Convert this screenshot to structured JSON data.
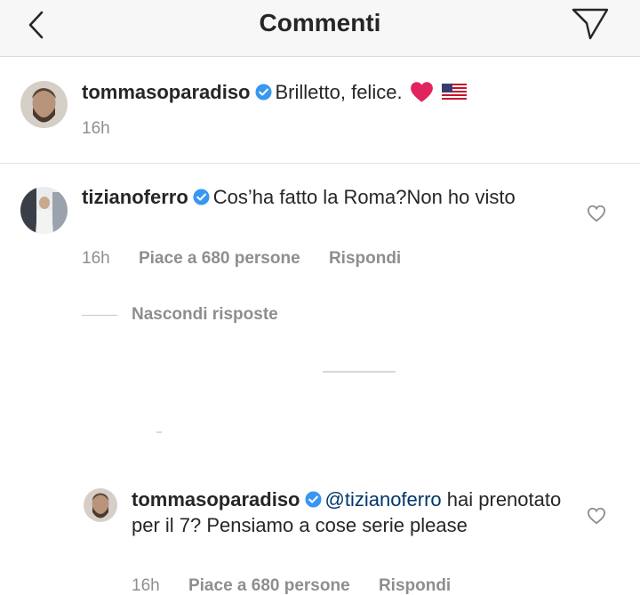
{
  "header": {
    "title": "Commenti",
    "back_icon": "chevron-left-icon",
    "send_icon": "paper-plane-icon"
  },
  "post": {
    "username": "tommasoparadiso",
    "verified": true,
    "caption": "Brilletto, felice.",
    "emojis": [
      "red-heart-icon",
      "us-flag-icon"
    ],
    "time": "16h"
  },
  "comments": [
    {
      "username": "tizianoferro",
      "verified": true,
      "text": "Cos’ha fatto la Roma?Non ho visto",
      "time": "16h",
      "likes": "Piace a 680 persone",
      "reply": "Rispondi",
      "hide_replies": "Nascondi risposte"
    }
  ],
  "replies": [
    {
      "username": "tommasoparadiso",
      "verified": true,
      "mention": "@tizianoferro",
      "text": " hai prenotato per il 7? Pensiamo a cose serie please",
      "time": "16h",
      "likes": "Piace a 680 persone",
      "reply": "Rispondi"
    }
  ],
  "colors": {
    "verified": "#3897f0",
    "mention": "#00376b",
    "secondary_text": "#8e8e8e",
    "heart": "#ed4956"
  }
}
